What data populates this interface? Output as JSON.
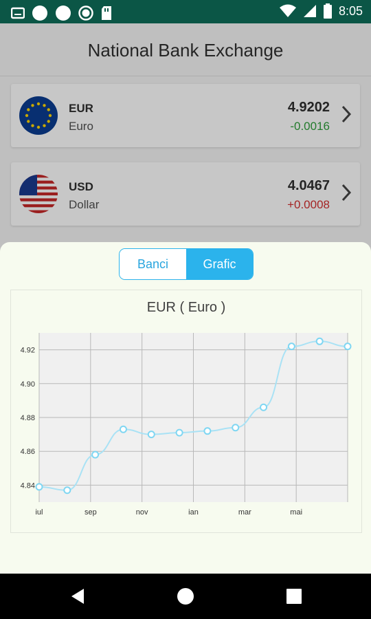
{
  "status_bar": {
    "time": "8:05"
  },
  "app": {
    "title": "National Bank Exchange"
  },
  "currencies": [
    {
      "code": "EUR",
      "name": "Euro",
      "rate": "4.9202",
      "change": "-0.0016",
      "change_color": "#2e9e3a"
    },
    {
      "code": "USD",
      "name": "Dollar",
      "rate": "4.0467",
      "change": "+0.0008",
      "change_color": "#d32f2f"
    }
  ],
  "sheet": {
    "tabs": [
      {
        "label": "Banci",
        "active": false
      },
      {
        "label": "Grafic",
        "active": true
      }
    ]
  },
  "colors": {
    "accent": "#2bb3ec",
    "status_bar": "#0b5646",
    "line": "#a9e2f5",
    "marker": "#7fd6f2"
  },
  "chart_data": {
    "type": "line",
    "title": "EUR ( Euro )",
    "xlabel": "",
    "ylabel": "",
    "x_tick_labels": [
      "iul",
      "sep",
      "nov",
      "ian",
      "mar",
      "mai"
    ],
    "y_tick_labels": [
      "4.84",
      "4.86",
      "4.88",
      "4.90",
      "4.92"
    ],
    "ylim": [
      4.83,
      4.93
    ],
    "grid": true,
    "x": [
      0,
      1,
      2,
      3,
      4,
      5,
      6,
      7,
      8,
      9,
      10,
      11
    ],
    "values": [
      4.839,
      4.837,
      4.858,
      4.873,
      4.87,
      4.871,
      4.872,
      4.874,
      4.886,
      4.922,
      4.925,
      4.922
    ]
  }
}
